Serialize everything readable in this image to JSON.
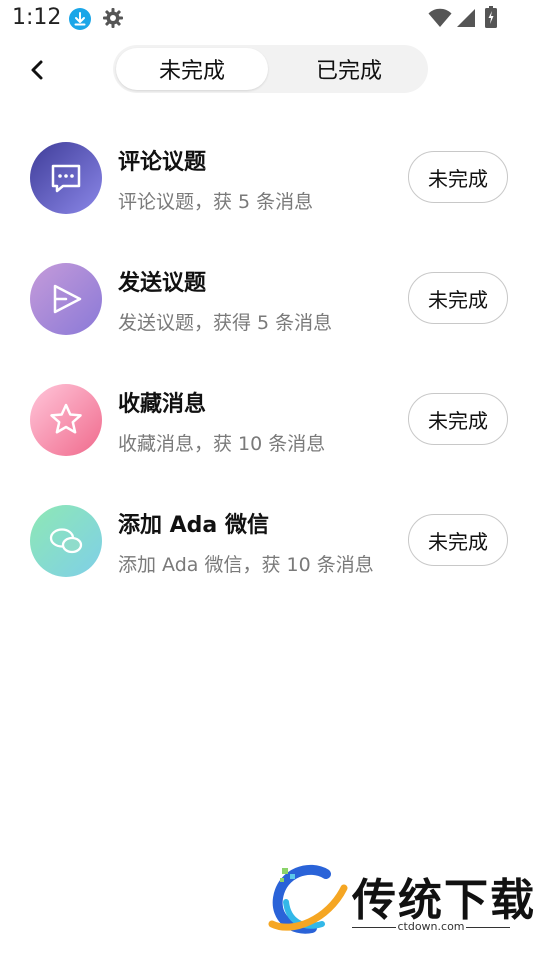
{
  "status_bar": {
    "time": "1:12",
    "icons": [
      "download-icon",
      "gear-icon",
      "wifi-icon",
      "signal-icon",
      "battery-icon"
    ]
  },
  "header": {
    "back_icon": "chevron-left-icon",
    "tabs": [
      {
        "label": "未完成",
        "active": true
      },
      {
        "label": "已完成",
        "active": false
      }
    ]
  },
  "tasks": [
    {
      "title": "评论议题",
      "description": "评论议题，获 5 条消息",
      "button": "未完成",
      "icon": "comment-icon",
      "colors": [
        "#3f3d99",
        "#8b87e8"
      ]
    },
    {
      "title": "发送议题",
      "description": "发送议题，获得 5 条消息",
      "button": "未完成",
      "icon": "send-icon",
      "colors": [
        "#b08ad6",
        "#8a79d8"
      ]
    },
    {
      "title": "收藏消息",
      "description": "收藏消息，获 10 条消息",
      "button": "未完成",
      "icon": "star-icon",
      "colors": [
        "#ffc1d5",
        "#f26d8f"
      ]
    },
    {
      "title": "添加 Ada 微信",
      "description": "添加 Ada 微信，获 10 条消息",
      "button": "未完成",
      "icon": "wechat-icon",
      "colors": [
        "#8fe7b8",
        "#7fd0e6"
      ]
    }
  ],
  "watermark": {
    "brand": "传统下载",
    "url": "ctdown.com"
  }
}
